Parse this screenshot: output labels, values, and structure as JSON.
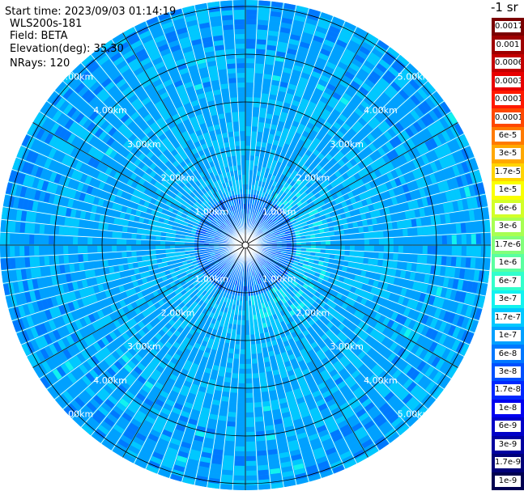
{
  "header": {
    "start_time": "Start time: 2023/09/03 01:14:19",
    "device": "WLS200s-181",
    "field": "Field: BETA",
    "elevation": "Elevation(deg): 35.30",
    "nrays": "NRays: 120"
  },
  "plot": {
    "nrays": 120,
    "ring_labels": [
      "1.00km",
      "2.00km",
      "3.00km",
      "4.00km",
      "5.00km"
    ],
    "colors": {
      "background": "#ffffff",
      "grid": "#000000",
      "ray_gap": "#ffffff",
      "range_label": "#ffffff"
    }
  },
  "legend": {
    "unit": "-1 sr",
    "levels": [
      {
        "label": "0.0017",
        "color": "#7a0000"
      },
      {
        "label": "0.001",
        "color": "#9e0000"
      },
      {
        "label": "0.0006",
        "color": "#c40000"
      },
      {
        "label": "0.0003",
        "color": "#e80000"
      },
      {
        "label": "0.00017",
        "color": "#ff1a00"
      },
      {
        "label": "0.0001",
        "color": "#ff4800"
      },
      {
        "label": "6e-5",
        "color": "#ff7a00"
      },
      {
        "label": "3e-5",
        "color": "#ffa800"
      },
      {
        "label": "1.7e-5",
        "color": "#ffd400"
      },
      {
        "label": "1e-5",
        "color": "#faff00"
      },
      {
        "label": "6e-6",
        "color": "#d2ff28"
      },
      {
        "label": "3e-6",
        "color": "#a8ff52"
      },
      {
        "label": "1.7e-6",
        "color": "#82ff7a"
      },
      {
        "label": "1e-6",
        "color": "#5affa0"
      },
      {
        "label": "6e-7",
        "color": "#32ffcc"
      },
      {
        "label": "3e-7",
        "color": "#12f2ef"
      },
      {
        "label": "1.7e-7",
        "color": "#00c8ff"
      },
      {
        "label": "1e-7",
        "color": "#00a0ff"
      },
      {
        "label": "6e-8",
        "color": "#0078ff"
      },
      {
        "label": "3e-8",
        "color": "#0050ff"
      },
      {
        "label": "1.7e-8",
        "color": "#0028ff"
      },
      {
        "label": "1e-8",
        "color": "#0000f0"
      },
      {
        "label": "6e-9",
        "color": "#0000c8"
      },
      {
        "label": "3e-9",
        "color": "#0000a0"
      },
      {
        "label": "1.7e-9",
        "color": "#000078"
      },
      {
        "label": "1e-9",
        "color": "#000050"
      }
    ]
  }
}
